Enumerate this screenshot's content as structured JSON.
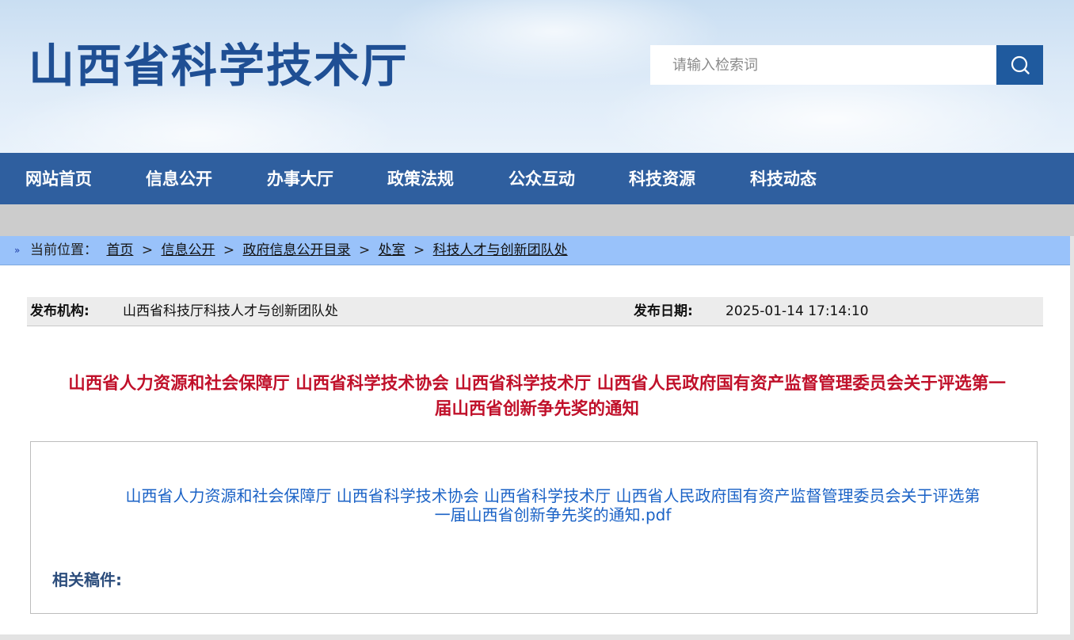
{
  "header": {
    "site_title": "山西省科学技术厅",
    "search": {
      "placeholder": "请输入检索词",
      "value": ""
    }
  },
  "nav": {
    "items": [
      {
        "label": "网站首页"
      },
      {
        "label": "信息公开"
      },
      {
        "label": "办事大厅"
      },
      {
        "label": "政策法规"
      },
      {
        "label": "公众互动"
      },
      {
        "label": "科技资源"
      },
      {
        "label": "科技动态"
      }
    ]
  },
  "breadcrumb": {
    "prefix": "当前位置：",
    "separator": ">",
    "items": [
      {
        "label": "首页"
      },
      {
        "label": "信息公开"
      },
      {
        "label": "政府信息公开目录"
      },
      {
        "label": "处室"
      },
      {
        "label": "科技人才与创新团队处"
      }
    ]
  },
  "meta": {
    "publisher_label": "发布机构:",
    "publisher_value": "山西省科技厅科技人才与创新团队处",
    "date_label": "发布日期:",
    "date_value": "2025-01-14 17:14:10"
  },
  "article": {
    "title_line1": "山西省人力资源和社会保障厅 山西省科学技术协会 山西省科学技术厅 山西省人民政府国有资产监督管理委员会关于评选第一",
    "title_line2": "届山西省创新争先奖的通知",
    "attachment_line1": "山西省人力资源和社会保障厅 山西省科学技术协会 山西省科学技术厅 山西省人民政府国有资产监督管理委员会关于评选第",
    "attachment_line2": "一届山西省创新争先奖的通知.pdf",
    "related_label": "相关稿件:"
  },
  "colors": {
    "nav_bg": "#2f5f9f",
    "title_text": "#1f4f94",
    "breadcrumb_bg": "#99c2fa",
    "article_title": "#c0102a",
    "link": "#1a62c6",
    "search_button": "#1f5a9e"
  },
  "icons": {
    "search_button": "search-icon",
    "breadcrumb_marker": "double-chevron-right-icon"
  }
}
